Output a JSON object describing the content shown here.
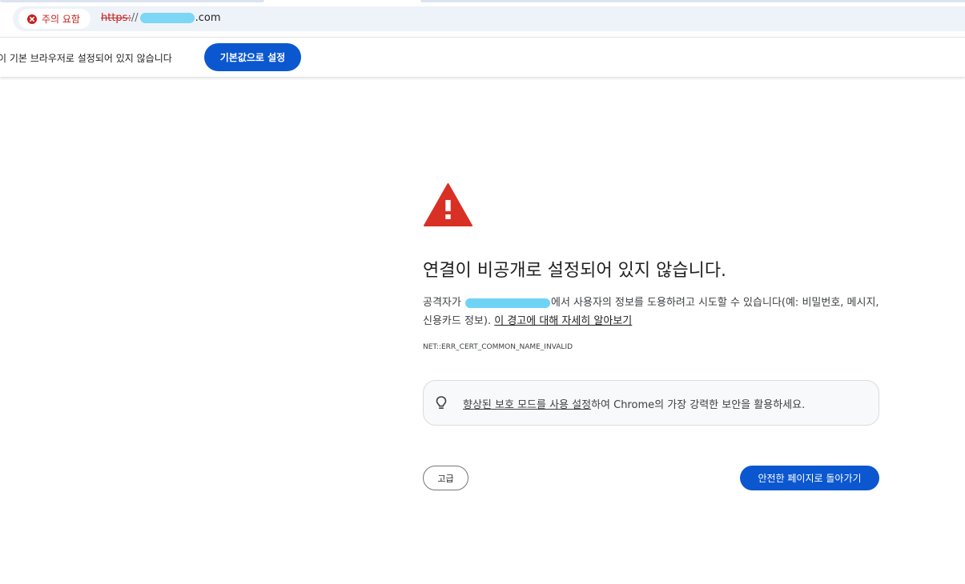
{
  "address_bar": {
    "security_chip_label": "주의 요함",
    "security_chip_icon": "error-x-icon",
    "url_scheme": "https:",
    "url_separator": "//",
    "url_tld": ".com"
  },
  "infobar": {
    "message": "이 기본 브라우저로 설정되어 있지 않습니다",
    "button_label": "기본값으로 설정"
  },
  "interstitial": {
    "icon": "warning-triangle-icon",
    "heading": "연결이 비공개로 설정되어 있지 않습니다.",
    "description_prefix": "공격자가 ",
    "description_suffix": "에서 사용자의 정보를 도용하려고 시도할 수 있습니다(예: 비밀번호, 메시지, 신용카드 정보). ",
    "learn_more_link": "이 경고에 대해 자세히 알아보기",
    "error_code": "NET::ERR_CERT_COMMON_NAME_INVALID",
    "promo": {
      "icon": "lightbulb-icon",
      "link_text": "향상된 보호 모드를 사용 설정",
      "trailing_text": "하여 Chrome의 가장 강력한 보안을 활용하세요."
    },
    "advanced_button": "고급",
    "back_button": "안전한 페이지로 돌아가기"
  },
  "colors": {
    "accent_blue": "#0b57d0",
    "danger_red": "#c5221f",
    "warning_triangle": "#d93025",
    "redaction": "#6fd3f5"
  }
}
